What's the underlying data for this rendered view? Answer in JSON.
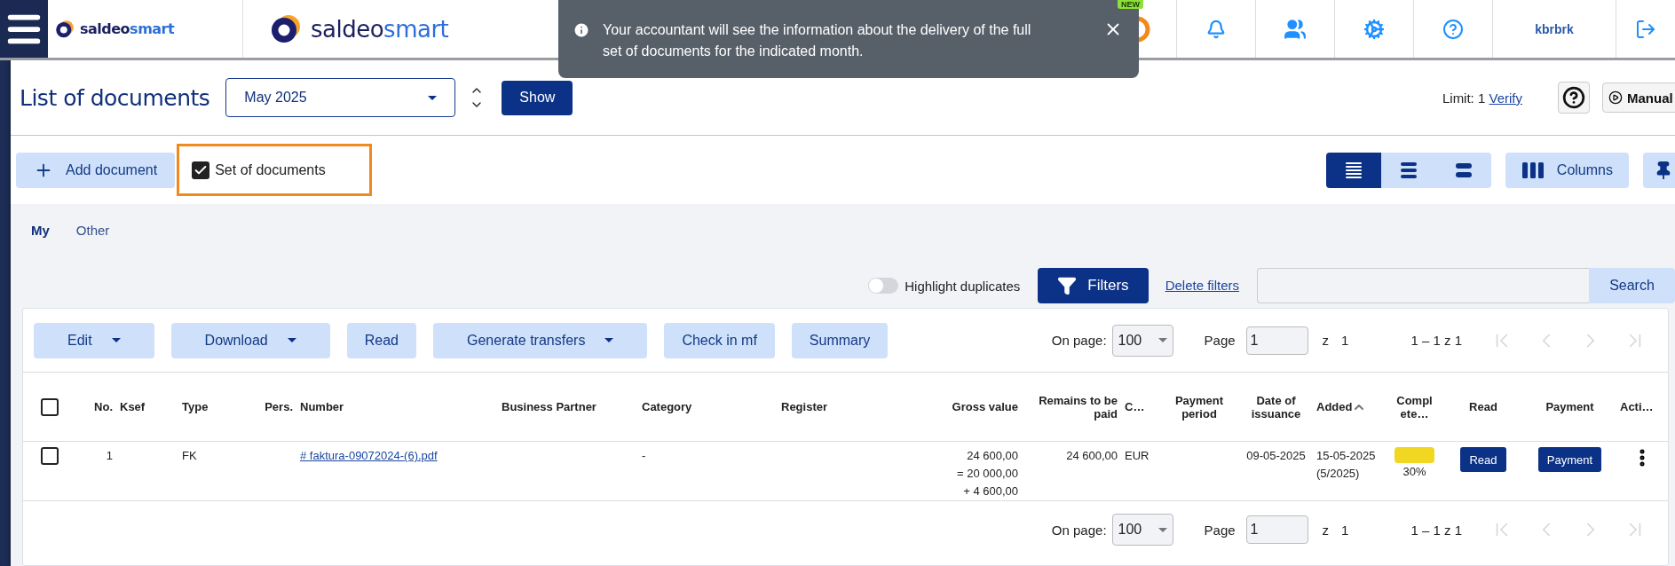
{
  "header": {
    "logo_small": {
      "brand": "saldeo",
      "suffix": "smart"
    },
    "logo_large": {
      "brand": "saldeo",
      "suffix": "smart"
    },
    "new_badge": "NEW",
    "user": "kbrbrk"
  },
  "toast": {
    "message": "Your accountant will see the information about the delivery of the full set of documents for the indicated month."
  },
  "page": {
    "title": "List of documents",
    "period": "May 2025",
    "show_button": "Show",
    "limit_label": "Limit: 1",
    "verify_link": "Verify",
    "manual_button": "Manual"
  },
  "toolbar": {
    "add_button": "Add document",
    "set_of_documents": {
      "label": "Set of documents",
      "checked": true
    },
    "view_modes": [
      {
        "selected": true
      },
      {
        "selected": false
      },
      {
        "selected": false
      }
    ],
    "columns_button": "Columns"
  },
  "tabs": [
    {
      "label": "My",
      "selected": true
    },
    {
      "label": "Other",
      "selected": false
    }
  ],
  "filters": {
    "highlight_duplicates": {
      "label": "Highlight duplicates",
      "on": false
    },
    "filters_button": "Filters",
    "delete_filters": "Delete filters",
    "search_button": "Search"
  },
  "actions": [
    {
      "label": "Edit",
      "dropdown": true
    },
    {
      "label": "Download",
      "dropdown": true
    },
    {
      "label": "Read",
      "dropdown": false
    },
    {
      "label": "Generate transfers",
      "dropdown": true
    },
    {
      "label": "Check in mf",
      "dropdown": false
    },
    {
      "label": "Summary",
      "dropdown": false
    }
  ],
  "pagers": [
    {
      "on_page_label": "On page:",
      "per_page": "100",
      "page_label": "Page",
      "page": "1",
      "of_label": "z",
      "pages": "1",
      "range": "1 – 1 z 1",
      "nav_disabled": true
    },
    {
      "on_page_label": "On page:",
      "per_page": "100",
      "page_label": "Page",
      "page": "1",
      "of_label": "z",
      "pages": "1",
      "range": "1 – 1 z 1",
      "nav_disabled": true
    }
  ],
  "table": {
    "all_checked": false,
    "columns": [
      {
        "label": "No.",
        "sorted": false
      },
      {
        "label": "Ksef",
        "sorted": false
      },
      {
        "label": "Type",
        "sorted": false
      },
      {
        "label": "Pers.",
        "sorted": false
      },
      {
        "label": "Number",
        "sorted": false
      },
      {
        "label": "Business Partner",
        "sorted": false
      },
      {
        "label": "Category",
        "sorted": false
      },
      {
        "label": "Register",
        "sorted": false
      },
      {
        "label": "Gross value",
        "sorted": false
      },
      {
        "label": "Remains to be paid",
        "sorted": false
      },
      {
        "label": "C…",
        "sorted": false
      },
      {
        "label": "Payment period",
        "sorted": false
      },
      {
        "label": "Date of issuance",
        "sorted": false
      },
      {
        "label": "Added",
        "sorted": true
      },
      {
        "label": "Complete…",
        "sorted": false
      },
      {
        "label": "Read",
        "sorted": false
      },
      {
        "label": "Payment",
        "sorted": false
      },
      {
        "label": "Acti…",
        "sorted": false
      }
    ],
    "rows": [
      {
        "checked": false,
        "no": "1",
        "type": "FK",
        "number": "# faktura-09072024-(6).pdf",
        "category": "-",
        "gross_value": [
          "24 600,00",
          "= 20 000,00",
          "+ 4 600,00"
        ],
        "remains": "24 600,00",
        "currency": "EUR",
        "date_of_issuance": "09-05-2025",
        "added": [
          "15-05-2025",
          "(5/2025)"
        ],
        "complete": "30%",
        "read_button": "Read",
        "payment_button": "Payment"
      }
    ]
  }
}
